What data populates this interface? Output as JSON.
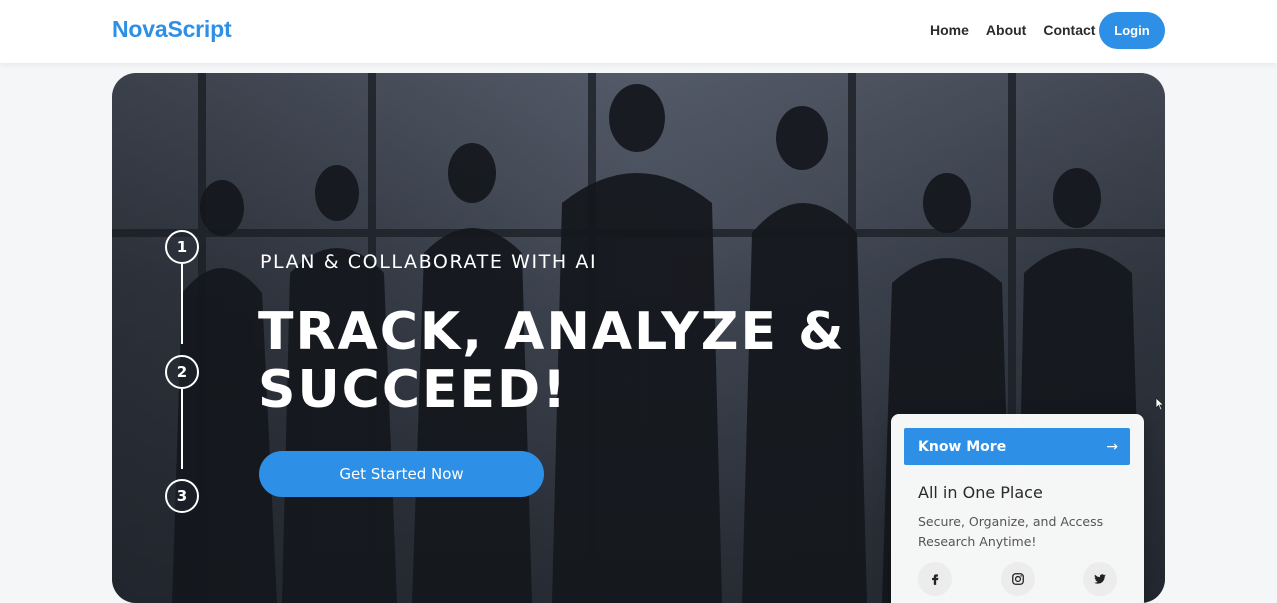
{
  "header": {
    "brand": "NovaScript",
    "nav": [
      "Home",
      "About",
      "Contact"
    ],
    "login_label": "Login"
  },
  "hero": {
    "steps": [
      "1",
      "2",
      "3"
    ],
    "eyebrow": "PLAN & COLLABORATE WITH AI",
    "headline_line1": "TRACK, ANALYZE &",
    "headline_line2": "SUCCEED!",
    "cta_label": "Get Started Now"
  },
  "card": {
    "button_label": "Know More",
    "button_arrow": "→",
    "title": "All in One Place",
    "description": "Secure, Organize, and Access Research Anytime!",
    "social_icons": [
      "facebook-icon",
      "instagram-icon",
      "twitter-icon"
    ]
  },
  "colors": {
    "accent": "#2e8fe6",
    "background": "#f4f6f8"
  }
}
